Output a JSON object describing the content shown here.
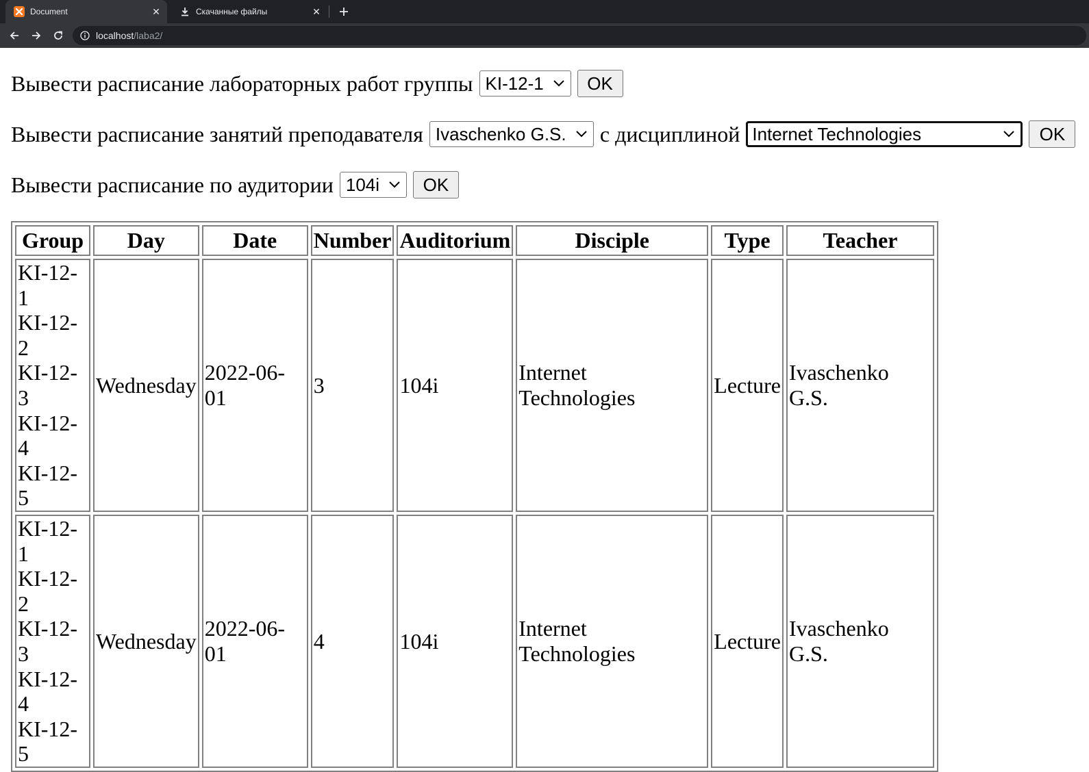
{
  "browser": {
    "tabs": [
      {
        "title": "Document",
        "active": true
      },
      {
        "title": "Скачанные файлы",
        "active": false
      }
    ],
    "address": {
      "host": "localhost",
      "path": "/laba2/"
    }
  },
  "forms": {
    "group": {
      "label": "Вывести расписание лабораторных работ группы",
      "selected": "KI-12-1",
      "button": "OK"
    },
    "teacher": {
      "label": "Вывести расписание занятий преподавателя",
      "selected": "Ivaschenko G.S.",
      "connector": "с дисциплиной",
      "discipline_selected": "Internet Technologies",
      "button": "OK"
    },
    "auditorium": {
      "label": "Вывести расписание по аудитории",
      "selected": "104i",
      "button": "OK"
    }
  },
  "table": {
    "headers": [
      "Group",
      "Day",
      "Date",
      "Number",
      "Auditorium",
      "Disciple",
      "Type",
      "Teacher"
    ],
    "rows": [
      {
        "groups": [
          "KI-12-1",
          "KI-12-2",
          "KI-12-3",
          "KI-12-4",
          "KI-12-5"
        ],
        "day": "Wednesday",
        "date": "2022-06-01",
        "number": "3",
        "auditorium": "104i",
        "discipline": "Internet Technologies",
        "type": "Lecture",
        "teacher": "Ivaschenko G.S."
      },
      {
        "groups": [
          "KI-12-1",
          "KI-12-2",
          "KI-12-3",
          "KI-12-4",
          "KI-12-5"
        ],
        "day": "Wednesday",
        "date": "2022-06-01",
        "number": "4",
        "auditorium": "104i",
        "discipline": "Internet Technologies",
        "type": "Lecture",
        "teacher": "Ivaschenko G.S."
      }
    ]
  }
}
